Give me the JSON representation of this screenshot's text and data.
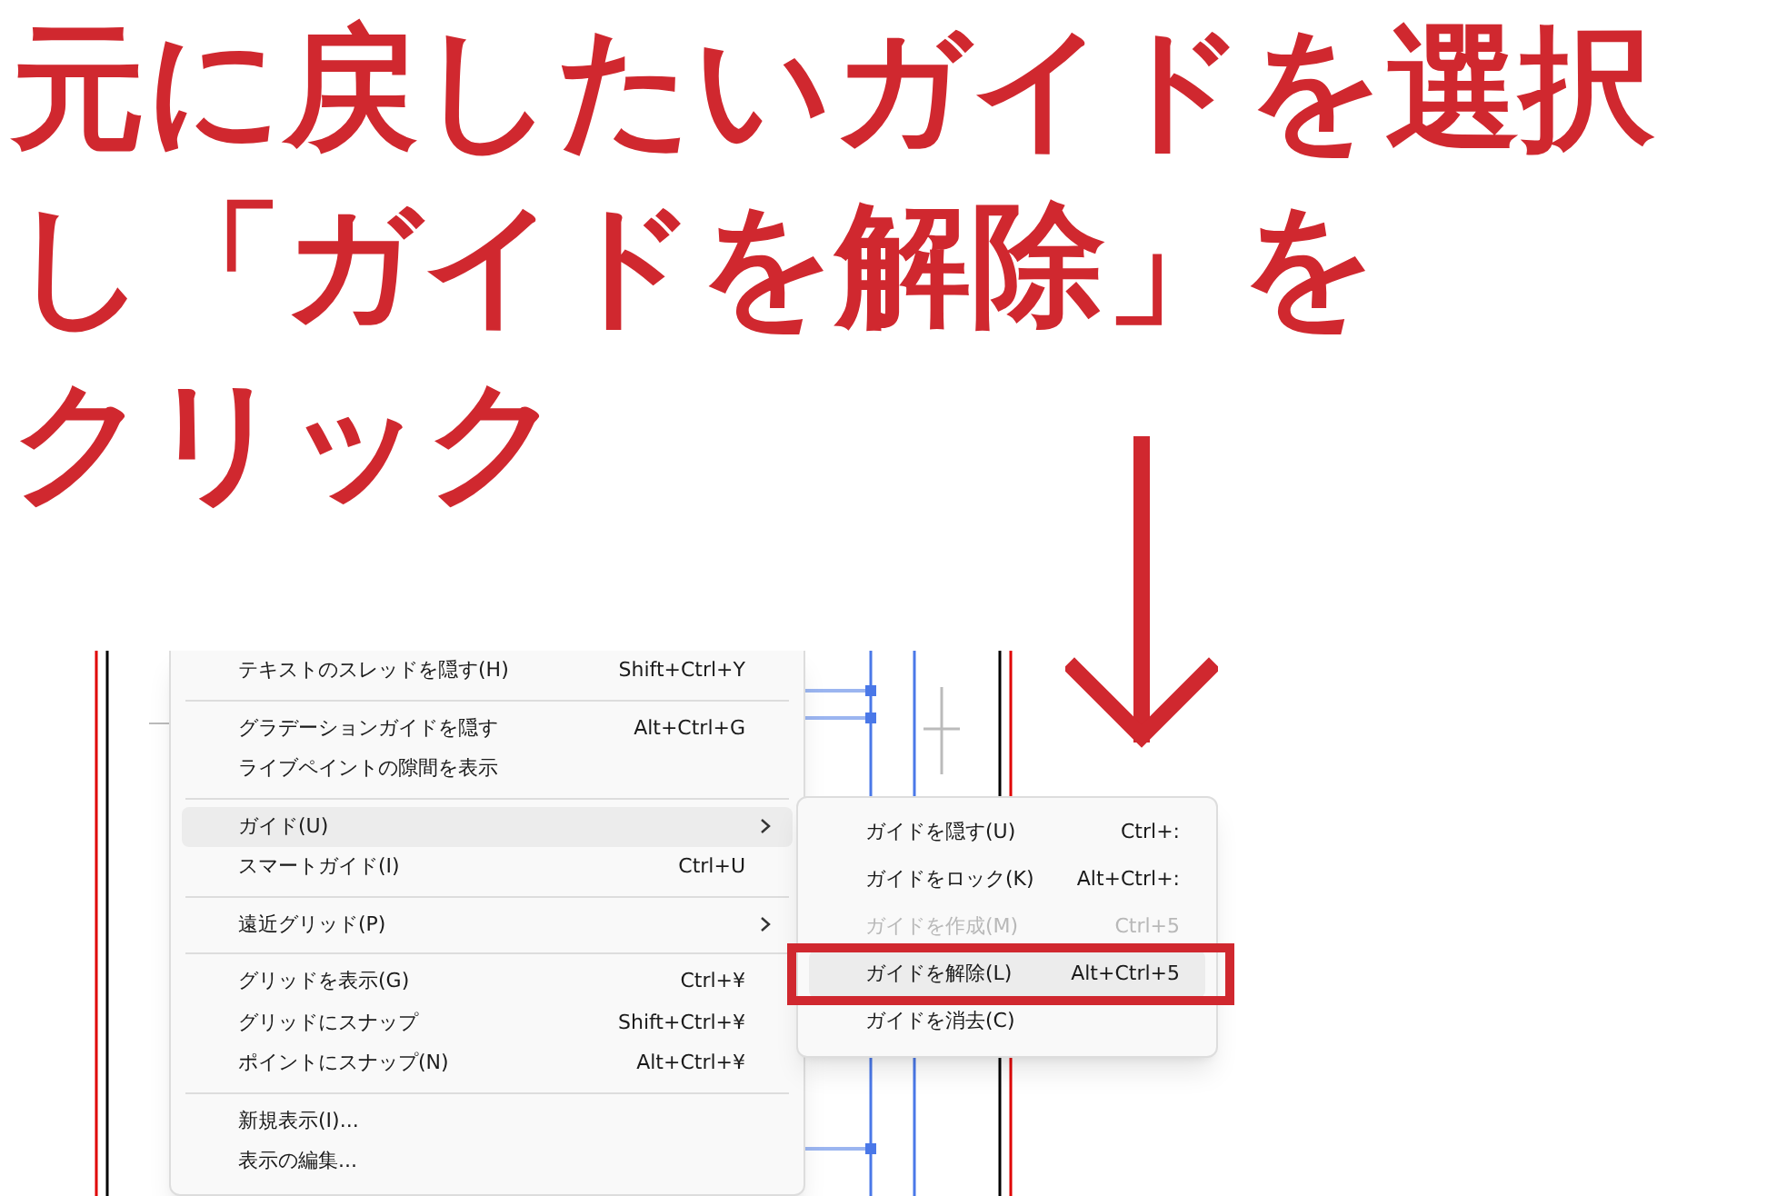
{
  "heading_lines": [
    "元に戻したいガイドを選択",
    "し「ガイドを解除」を",
    "クリック"
  ],
  "view_menu": [
    {
      "kind": "item",
      "label": "テキストのスレッドを隠す(H)",
      "shortcut": "Shift+Ctrl+Y",
      "submenu": false,
      "selected": false
    },
    {
      "kind": "separator"
    },
    {
      "kind": "item",
      "label": "グラデーションガイドを隠す",
      "shortcut": "Alt+Ctrl+G",
      "submenu": false,
      "selected": false
    },
    {
      "kind": "item",
      "label": "ライブペイントの隙間を表示",
      "submenu": false,
      "selected": false
    },
    {
      "kind": "separator"
    },
    {
      "kind": "item",
      "label": "ガイド(U)",
      "submenu": true,
      "selected": true
    },
    {
      "kind": "item",
      "label": "スマートガイド(I)",
      "shortcut": "Ctrl+U",
      "submenu": false,
      "selected": false
    },
    {
      "kind": "separator"
    },
    {
      "kind": "item",
      "label": "遠近グリッド(P)",
      "submenu": true,
      "selected": false
    },
    {
      "kind": "separator"
    },
    {
      "kind": "item",
      "label": "グリッドを表示(G)",
      "shortcut": "Ctrl+¥",
      "submenu": false,
      "selected": false
    },
    {
      "kind": "item",
      "label": "グリッドにスナップ",
      "shortcut": "Shift+Ctrl+¥",
      "submenu": false,
      "selected": false
    },
    {
      "kind": "item",
      "label": "ポイントにスナップ(N)",
      "shortcut": "Alt+Ctrl+¥",
      "submenu": false,
      "selected": false
    },
    {
      "kind": "separator"
    },
    {
      "kind": "item",
      "label": "新規表示(I)...",
      "submenu": false,
      "selected": false
    },
    {
      "kind": "item",
      "label": "表示の編集...",
      "submenu": false,
      "selected": false
    }
  ],
  "guide_submenu": [
    {
      "label": "ガイドを隠す(U)",
      "shortcut": "Ctrl+:",
      "disabled": false,
      "selected": false
    },
    {
      "label": "ガイドをロック(K)",
      "shortcut": "Alt+Ctrl+:",
      "disabled": false,
      "selected": false
    },
    {
      "label": "ガイドを作成(M)",
      "shortcut": "Ctrl+5",
      "disabled": true,
      "selected": false
    },
    {
      "label": "ガイドを解除(L)",
      "shortcut": "Alt+Ctrl+5",
      "disabled": false,
      "selected": true
    },
    {
      "label": "ガイドを消去(C)",
      "disabled": false,
      "selected": false
    }
  ]
}
